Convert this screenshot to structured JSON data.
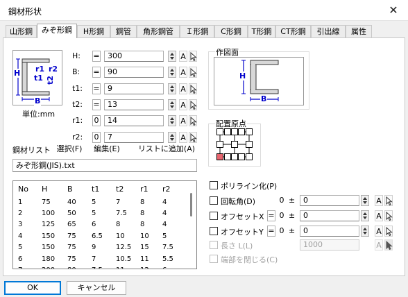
{
  "window": {
    "title": "鋼材形状",
    "close_glyph": "✕"
  },
  "tabs": [
    {
      "label": "山形鋼",
      "active": false
    },
    {
      "label": "みぞ形鋼",
      "active": true
    },
    {
      "label": "H形鋼",
      "active": false
    },
    {
      "label": "鋼管",
      "active": false
    },
    {
      "label": "角形鋼管",
      "active": false
    },
    {
      "label": "Ｉ形鋼",
      "active": false
    },
    {
      "label": "C形鋼",
      "active": false
    },
    {
      "label": "T形鋼",
      "active": false
    },
    {
      "label": "CT形鋼",
      "active": false
    },
    {
      "label": "引出線",
      "active": false
    },
    {
      "label": "属性",
      "active": false
    }
  ],
  "shape_preview": {
    "labels": {
      "H": "H",
      "B": "B",
      "r1": "r1",
      "r2": "r2",
      "t1": "t1",
      "t2": "t2"
    },
    "unit": "単位:mm"
  },
  "params": [
    {
      "label": "H:",
      "eq": "=",
      "value": "300",
      "a": "A"
    },
    {
      "label": "B:",
      "eq": "=",
      "value": "90",
      "a": "A"
    },
    {
      "label": "t1:",
      "eq": "=",
      "value": "9",
      "a": "A"
    },
    {
      "label": "t2:",
      "eq": "=",
      "value": "13",
      "a": "A"
    },
    {
      "label": "r1:",
      "eq": "0",
      "value": "14",
      "a": "A"
    },
    {
      "label": "r2:",
      "eq": "0",
      "value": "7",
      "a": "A"
    }
  ],
  "drawing_group": {
    "title": "作図面",
    "H": "H",
    "B": "B"
  },
  "origin_group": {
    "title": "配置原点"
  },
  "list": {
    "label": "鋼材リスト",
    "select_btn": "選択(F)",
    "edit_btn": "編集(E)",
    "add_btn": "リストに追加(A)",
    "file": "みぞ形鋼(JIS).txt",
    "columns": [
      "No",
      "H",
      "B",
      "t1",
      "t2",
      "r1",
      "r2"
    ],
    "rows": [
      [
        "1",
        "75",
        "40",
        "5",
        "7",
        "8",
        "4"
      ],
      [
        "2",
        "100",
        "50",
        "5",
        "7.5",
        "8",
        "4"
      ],
      [
        "3",
        "125",
        "65",
        "6",
        "8",
        "8",
        "4"
      ],
      [
        "4",
        "150",
        "75",
        "6.5",
        "10",
        "10",
        "5"
      ],
      [
        "5",
        "150",
        "75",
        "9",
        "12.5",
        "15",
        "7.5"
      ],
      [
        "6",
        "180",
        "75",
        "7",
        "10.5",
        "11",
        "5.5"
      ],
      [
        "7",
        "200",
        "80",
        "7.5",
        "11",
        "12",
        "6"
      ]
    ]
  },
  "options": {
    "polyline": "ポリライン化(P)",
    "rotation": {
      "label": "回転角(D)",
      "eq": "0",
      "pm": "±",
      "value": "0",
      "a": "A"
    },
    "offset_x": {
      "label": "オフセットX",
      "eq": "=",
      "eq2": "0",
      "pm": "±",
      "value": "0",
      "a": "A"
    },
    "offset_y": {
      "label": "オフセットY",
      "eq": "=",
      "eq2": "0",
      "pm": "±",
      "value": "0",
      "a": "A"
    },
    "length": {
      "label": "長さ L(L)",
      "value": "1000",
      "a": "A"
    },
    "close_ends": "端部を閉じる(C)"
  },
  "footer": {
    "ok": "OK",
    "cancel": "キャンセル"
  },
  "colors": {
    "accent": "#0078d7",
    "highlight": "#e8656f",
    "label_blue": "#0000cc"
  }
}
